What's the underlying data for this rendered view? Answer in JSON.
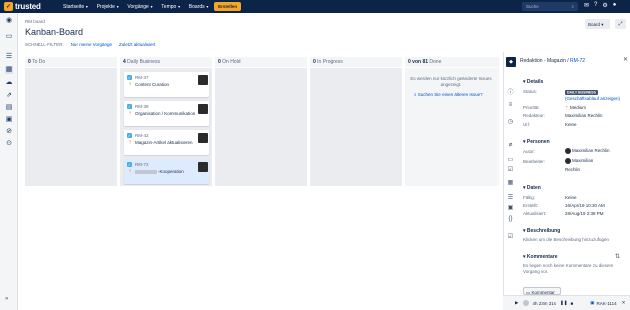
{
  "topnav": {
    "logo_text": "trusted",
    "items": [
      "Startseite",
      "Projekte",
      "Vorgänge",
      "Tempo",
      "Boards"
    ],
    "create_label": "Erstellen",
    "search_placeholder": "Suche"
  },
  "header": {
    "breadcrumb": "RM board",
    "title": "Kanban-Board",
    "board_button": "Board",
    "filters_label": "SCHNELL-FILTER:",
    "filter_links": [
      "Nur meine Vorgänge",
      "Zuletzt aktualisiert"
    ]
  },
  "columns": [
    {
      "count": "0",
      "name": "To Do"
    },
    {
      "count": "4",
      "name": "Daily Business"
    },
    {
      "count": "0",
      "name": "On Hold"
    },
    {
      "count": "0",
      "name": "In Progress"
    },
    {
      "count": "0 von 81",
      "name": "Done"
    }
  ],
  "cards": [
    {
      "key": "RM-37",
      "summary": "Content Curation"
    },
    {
      "key": "RM-39",
      "summary": "Organisation / Kommunikation"
    },
    {
      "key": "RM-42",
      "summary": "Magazin-Artikel aktualisieren"
    },
    {
      "key": "RM-72",
      "summary": "-Kooperation"
    }
  ],
  "done_column": {
    "message": "Es werden nur kürzlich geänderte Issues angezeigt.",
    "link": "Suchen Sie einen älteren Issue?"
  },
  "detail": {
    "project": "Redaktion - Magazin /",
    "issue_key": "RM-72",
    "sections": {
      "details": "Details",
      "people": "Personen",
      "dates": "Daten",
      "description": "Beschreibung",
      "comments": "Kommentare"
    },
    "details": {
      "status_label": "Status:",
      "status_value": "DAILY BUSINESS",
      "workflow_link": "(Geschäftsablauf anzeigen)",
      "priority_label": "Priorität:",
      "priority_value": "Medium",
      "editor_label": "Redakteur:",
      "editor_value": "Maximilian Rechlin",
      "url_label": "Url:",
      "url_value": "Keine"
    },
    "people": {
      "author_label": "Autor:",
      "author_value": "Maximilian Rechlin",
      "assignee_label": "Bearbeiter:",
      "assignee_first": "Maximilian",
      "assignee_last": "Rechlin"
    },
    "dates": {
      "due_label": "Fällig:",
      "due_value": "Keine",
      "created_label": "Erstellt:",
      "created_value": "16/Apr/19 10:30 AM",
      "updated_label": "Aktualisiert:",
      "updated_value": "28/Aug/19 2:38 PM"
    },
    "description_text": "Klicken um die Beschreibung hinzuzufügen",
    "comments_text": "Es liegen noch keine Kommentare zu diesem Vorgang vor.",
    "comment_button": "Kommentar"
  },
  "footer": {
    "timer": "4h 23m 31s",
    "issue": "RAK-1114"
  }
}
